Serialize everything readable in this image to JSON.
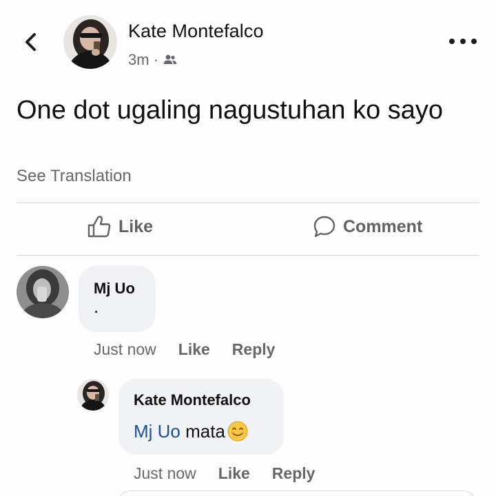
{
  "post": {
    "author": "Kate Montefalco",
    "time": "3m",
    "separator": "·",
    "audience_icon": "friends-icon",
    "text": "One dot ugaling nagustuhan ko sayo",
    "see_translation": "See Translation"
  },
  "actions": {
    "like_label": "Like",
    "comment_label": "Comment"
  },
  "comments": [
    {
      "author": "Mj Uo",
      "text": ".",
      "time": "Just now",
      "like_label": "Like",
      "reply_label": "Reply"
    },
    {
      "author": "Kate Montefalco",
      "mention": "Mj Uo",
      "text": "mata",
      "emoji": "smiling-face-emoji",
      "time": "Just now",
      "like_label": "Like",
      "reply_label": "Reply"
    }
  ],
  "colors": {
    "text": "#111111",
    "muted": "#65676b",
    "bubble": "#f0f2f5",
    "mention": "#1c4f9c",
    "divider": "#d5d7db"
  }
}
